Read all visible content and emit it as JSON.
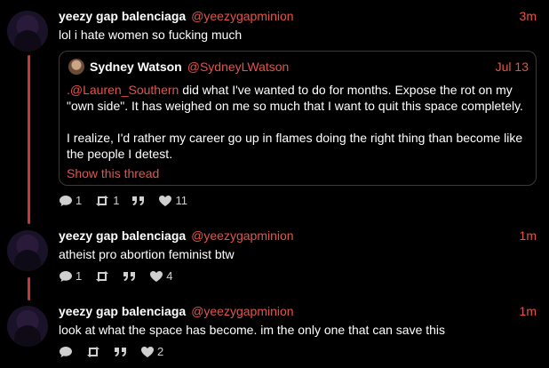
{
  "tweets": [
    {
      "name": "yeezy gap balenciaga",
      "handle": "@yeezygapminion",
      "time": "3m",
      "text": "lol i hate women so fucking much",
      "replies": "1",
      "retweets": "1",
      "likes": "11"
    },
    {
      "name": "yeezy gap balenciaga",
      "handle": "@yeezygapminion",
      "time": "1m",
      "text": "atheist pro abortion feminist btw",
      "replies": "1",
      "retweets": "",
      "likes": "4"
    },
    {
      "name": "yeezy gap balenciaga",
      "handle": "@yeezygapminion",
      "time": "1m",
      "text": "look at what the space has become. im the only one that can save this",
      "replies": "",
      "retweets": "",
      "likes": "2"
    }
  ],
  "quote": {
    "name": "Sydney Watson",
    "handle": "@SydneyLWatson",
    "time": "Jul 13",
    "mention": ".@Lauren_Southern",
    "line1_rest": " did what I've wanted to do for months. Expose the rot on my",
    "line2": "\"own side\". It has weighed on me so much that I want to quit this space completely.",
    "para2_line1": "I realize, I'd rather my career go up in flames doing the right thing than become like",
    "para2_line2": "the people I detest.",
    "show_thread": "Show this thread"
  },
  "icons": [
    "reply-icon",
    "retweet-icon",
    "quote-icon",
    "like-icon"
  ],
  "colors": {
    "accent": "#e5534b",
    "thread_line": "#c8383a",
    "background": "#000000"
  }
}
